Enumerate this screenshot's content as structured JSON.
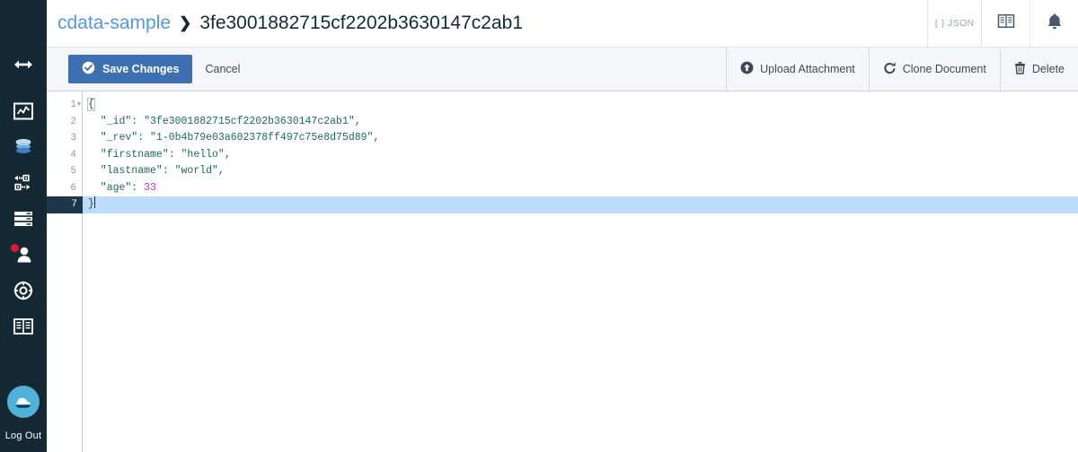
{
  "sidebar": {
    "items": [
      {
        "icon": "expand-arrows-icon",
        "name": "sidebar-item-expand"
      },
      {
        "icon": "monitoring-chart-icon",
        "name": "sidebar-item-monitoring"
      },
      {
        "icon": "database-icon",
        "name": "sidebar-item-databases"
      },
      {
        "icon": "replication-icon",
        "name": "sidebar-item-replication"
      },
      {
        "icon": "list-rows-icon",
        "name": "sidebar-item-activity"
      },
      {
        "icon": "user-icon",
        "name": "sidebar-item-account",
        "badge": true
      },
      {
        "icon": "lifebuoy-icon",
        "name": "sidebar-item-support"
      },
      {
        "icon": "book-icon",
        "name": "sidebar-item-docs"
      }
    ],
    "logo": "cloud-logo",
    "logout_label": "Log Out",
    "background": "#152935",
    "badge_color": "#e0182d",
    "logo_color": "#4fb3d9"
  },
  "header": {
    "breadcrumb": {
      "database": "cdata-sample",
      "separator": "❯",
      "document_id": "3fe3001882715cf2202b3630147c2ab1"
    },
    "actions": [
      {
        "label": "{ } JSON",
        "name": "json-view-tab"
      },
      {
        "label": "",
        "name": "docs-book-icon"
      },
      {
        "label": "",
        "name": "notifications-bell-icon"
      }
    ],
    "link_color": "#5596e6"
  },
  "toolbar": {
    "save_label": "Save Changes",
    "cancel_label": "Cancel",
    "upload_label": "Upload Attachment",
    "clone_label": "Clone Document",
    "delete_label": "Delete",
    "save_color": "#3d70b2",
    "background": "#f4f6fa"
  },
  "editor": {
    "active_line": 7,
    "gutter_numbers": [
      "1",
      "2",
      "3",
      "4",
      "5",
      "6",
      "7"
    ],
    "lines": [
      {
        "n": "1",
        "text": "{"
      },
      {
        "n": "2",
        "text": "  \"_id\": \"3fe3001882715cf2202b3630147c2ab1\","
      },
      {
        "n": "3",
        "text": "  \"_rev\": \"1-0b4b79e03a602378ff497c75e8d75d89\","
      },
      {
        "n": "4",
        "text": "  \"firstname\": \"hello\","
      },
      {
        "n": "5",
        "text": "  \"lastname\": \"world\","
      },
      {
        "n": "6",
        "text": "  \"age\": 33"
      },
      {
        "n": "7",
        "text": "}"
      }
    ],
    "document": {
      "_id": "3fe3001882715cf2202b3630147c2ab1",
      "_rev": "1-0b4b79e03a602378ff497c75e8d75d89",
      "firstname": "hello",
      "lastname": "world",
      "age": 33
    },
    "highlight_color": "#bcdcfc",
    "active_gutter_color": "#1d3649",
    "string_color": "#1c6b5e",
    "number_color": "#c832c8"
  }
}
